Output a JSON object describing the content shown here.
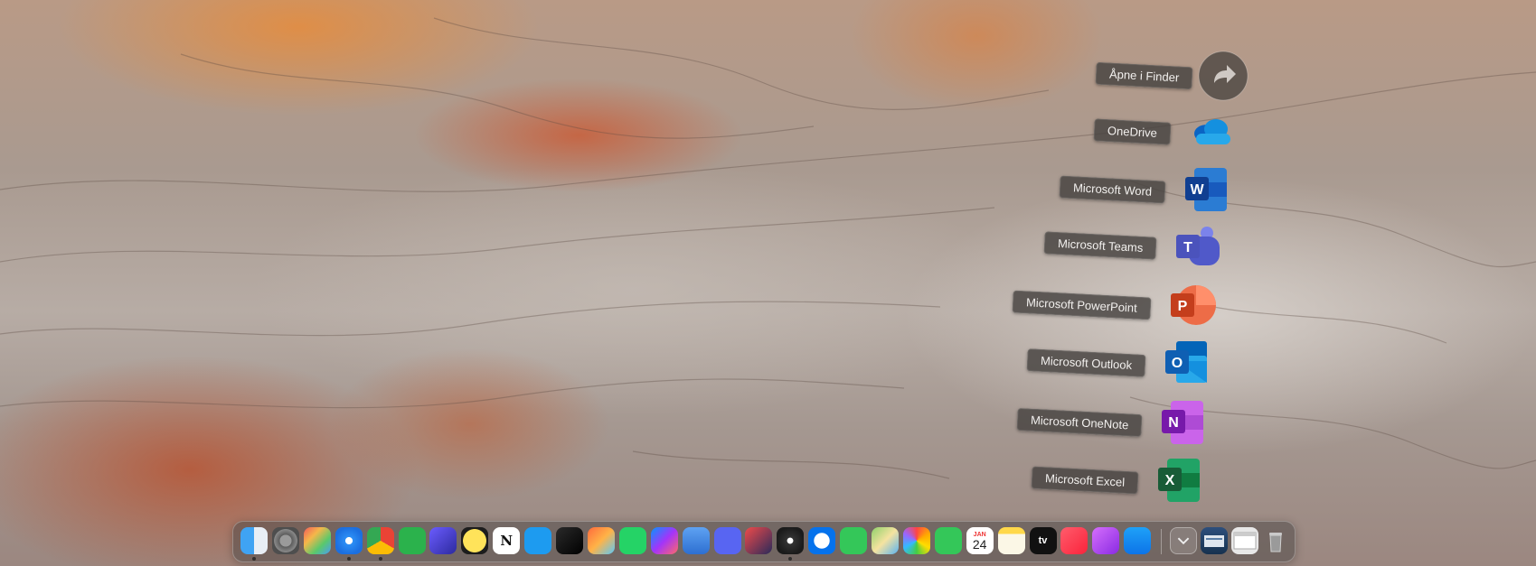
{
  "desktop": {
    "wallpaper": "rock-landscape",
    "colors": {
      "sand_orange": "#d9894a",
      "rock_red": "#c4553a",
      "rock_grey": "#b4aaa3"
    }
  },
  "stack": {
    "items": [
      {
        "label": "Åpne i Finder",
        "icon": "arrow-forward-icon",
        "name": "stack-open-in-finder"
      },
      {
        "label": "OneDrive",
        "icon": "onedrive-icon",
        "name": "stack-onedrive"
      },
      {
        "label": "Microsoft Word",
        "icon": "word-icon",
        "name": "stack-word",
        "letter": "W"
      },
      {
        "label": "Microsoft Teams",
        "icon": "teams-icon",
        "name": "stack-teams",
        "letter": "T"
      },
      {
        "label": "Microsoft PowerPoint",
        "icon": "powerpoint-icon",
        "name": "stack-powerpoint",
        "letter": "P"
      },
      {
        "label": "Microsoft Outlook",
        "icon": "outlook-icon",
        "name": "stack-outlook",
        "letter": "O"
      },
      {
        "label": "Microsoft OneNote",
        "icon": "onenote-icon",
        "name": "stack-onenote",
        "letter": "N"
      },
      {
        "label": "Microsoft Excel",
        "icon": "excel-icon",
        "name": "stack-excel",
        "letter": "X"
      }
    ]
  },
  "dock": {
    "apps": [
      {
        "icon": "finder-icon",
        "running": true
      },
      {
        "icon": "system-settings-icon",
        "running": false
      },
      {
        "icon": "launchpad-icon",
        "running": false
      },
      {
        "icon": "safari-icon",
        "running": true
      },
      {
        "icon": "chrome-icon",
        "running": true
      },
      {
        "icon": "feedly-icon",
        "running": false
      },
      {
        "icon": "hand-app-icon",
        "running": false
      },
      {
        "icon": "basecamp-icon",
        "running": false
      },
      {
        "icon": "notion-icon",
        "running": false,
        "glyph": "N"
      },
      {
        "icon": "twitter-icon",
        "running": false
      },
      {
        "icon": "final-cut-icon",
        "running": false
      },
      {
        "icon": "pixelmator-icon",
        "running": false
      },
      {
        "icon": "whatsapp-icon",
        "running": false
      },
      {
        "icon": "messenger-icon",
        "running": false
      },
      {
        "icon": "screenshot-icon",
        "running": false
      },
      {
        "icon": "discord-icon",
        "running": false
      },
      {
        "icon": "affinity-icon",
        "running": false
      },
      {
        "icon": "obs-icon",
        "running": true
      },
      {
        "icon": "onepassword-icon",
        "running": false
      },
      {
        "icon": "messages-icon",
        "running": false
      },
      {
        "icon": "maps-icon",
        "running": false
      },
      {
        "icon": "photos-icon",
        "running": false
      },
      {
        "icon": "facetime-icon",
        "running": false
      },
      {
        "icon": "calendar-icon",
        "running": false,
        "month": "JAN",
        "day": "24"
      },
      {
        "icon": "notes-icon",
        "running": false
      },
      {
        "icon": "apple-tv-icon",
        "running": false,
        "glyph": "tv"
      },
      {
        "icon": "music-icon",
        "running": false
      },
      {
        "icon": "podcasts-icon",
        "running": false
      },
      {
        "icon": "app-store-icon",
        "running": false
      }
    ],
    "right": [
      {
        "icon": "downloads-folder-icon"
      },
      {
        "icon": "screenshot-thumbnail-icon"
      },
      {
        "icon": "chrome-window-thumbnail-icon"
      },
      {
        "icon": "trash-icon"
      }
    ]
  }
}
